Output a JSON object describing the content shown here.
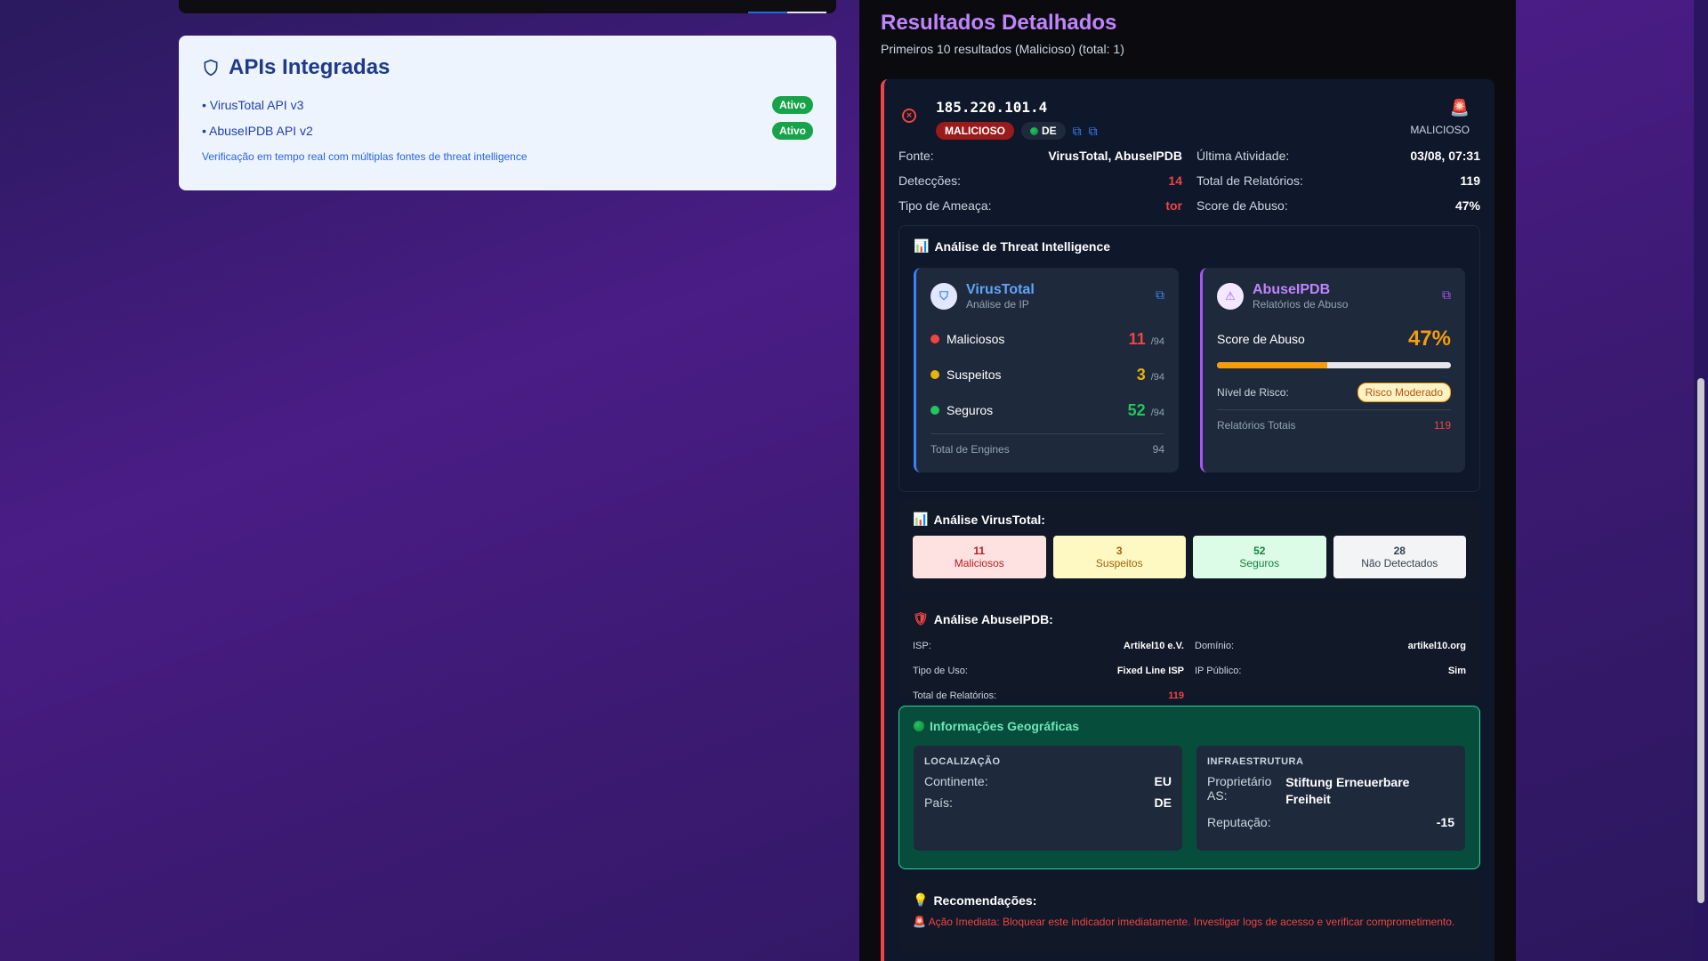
{
  "apis": {
    "title": "APIs Integradas",
    "items": [
      {
        "label": "• VirusTotal API v3",
        "status": "Ativo"
      },
      {
        "label": "• AbuseIPDB API v2",
        "status": "Ativo"
      }
    ],
    "description": "Verificação em tempo real com múltiplas fontes de threat intelligence"
  },
  "results": {
    "title": "Resultados Detalhados",
    "subtitle": "Primeiros 10 resultados (Malicioso) (total: 1)",
    "item": {
      "ip": "185.220.101.4",
      "verdict_tag": "MALICIOSO",
      "country_code": "DE",
      "verdict_label": "MALICIOSO",
      "facts": {
        "fonte_label": "Fonte:",
        "fonte": "VirusTotal, AbuseIPDB",
        "atividade_label": "Última Atividade:",
        "atividade": "03/08, 07:31",
        "deteccoes_label": "Detecções:",
        "deteccoes": "14",
        "relatorios_label": "Total de Relatórios:",
        "relatorios": "119",
        "tipo_label": "Tipo de Ameaça:",
        "tipo": "tor",
        "score_label": "Score de Abuso:",
        "score": "47%"
      }
    }
  },
  "threat_intel": {
    "title": "Análise de Threat Intelligence",
    "virustotal": {
      "name": "VirusTotal",
      "subtitle": "Análise de IP",
      "rows": [
        {
          "label": "Maliciosos",
          "value": "11",
          "of": "/94"
        },
        {
          "label": "Suspeitos",
          "value": "3",
          "of": "/94"
        },
        {
          "label": "Seguros",
          "value": "52",
          "of": "/94"
        }
      ],
      "total_label": "Total de Engines",
      "total": "94"
    },
    "abuseipdb": {
      "name": "AbuseIPDB",
      "subtitle": "Relatórios de Abuso",
      "score_label": "Score de Abuso",
      "score": "47%",
      "score_fraction": 0.47,
      "risk_label": "Nível de Risco:",
      "risk": "Risco Moderado",
      "reports_label": "Relatórios Totais",
      "reports": "119"
    }
  },
  "vt_summary": {
    "title": "Análise VirusTotal:",
    "cells": [
      {
        "value": "11",
        "label": "Maliciosos"
      },
      {
        "value": "3",
        "label": "Suspeitos"
      },
      {
        "value": "52",
        "label": "Seguros"
      },
      {
        "value": "28",
        "label": "Não Detectados"
      }
    ]
  },
  "abuse_analysis": {
    "title": "Análise AbuseIPDB:",
    "isp_label": "ISP:",
    "isp": "Artikel10 e.V.",
    "dominio_label": "Domínio:",
    "dominio": "artikel10.org",
    "uso_label": "Tipo de Uso:",
    "uso": "Fixed Line ISP",
    "publico_label": "IP Público:",
    "publico": "Sim",
    "total_label": "Total de Relatórios:",
    "total": "119"
  },
  "geo": {
    "title": "Informações Geográficas",
    "loc_heading": "LOCALIZAÇÃO",
    "continente_label": "Continente:",
    "continente": "EU",
    "pais_label": "País:",
    "pais": "DE",
    "infra_heading": "INFRAESTRUTURA",
    "as_label": "Proprietário AS:",
    "as": "Stiftung Erneuerbare Freiheit",
    "rep_label": "Reputação:",
    "rep": "-15"
  },
  "recommendations": {
    "title": "Recomendações:",
    "text": "Ação Imediata: Bloquear este indicador imediatamente. Investigar logs de acesso e verificar comprometimento."
  },
  "colors": {
    "malicious": "#ef4444",
    "suspicious": "#eab308",
    "safe": "#22c55e",
    "accent_purple": "#c084fc"
  }
}
